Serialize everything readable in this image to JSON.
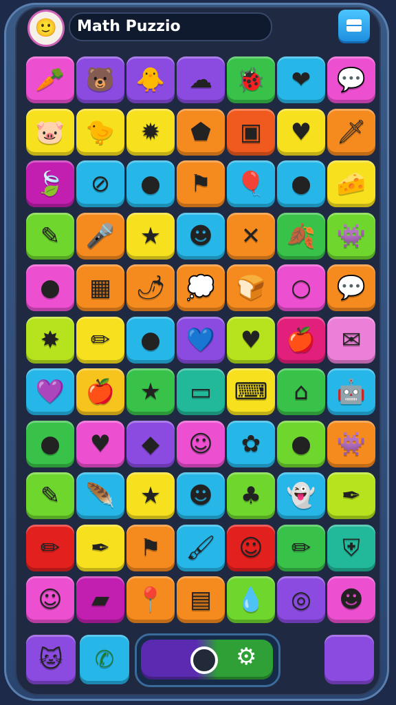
{
  "header": {
    "title": "Math Puzzio",
    "avatar_icon": "smiling-face-avatar",
    "menu_icon": "window-icon"
  },
  "tiles": [
    {
      "color": "#ec4fd0",
      "icon": "leaf-icon",
      "glyph": "🥕"
    },
    {
      "color": "#8b4be0",
      "icon": "bear-icon",
      "glyph": "🐻"
    },
    {
      "color": "#8b4be0",
      "icon": "chick-icon",
      "glyph": "🐥"
    },
    {
      "color": "#8b4be0",
      "icon": "blob-icon",
      "glyph": "☁"
    },
    {
      "color": "#39c24a",
      "icon": "bug-face-icon",
      "glyph": "🐞"
    },
    {
      "color": "#26b6e8",
      "icon": "heart-icon",
      "glyph": "❤"
    },
    {
      "color": "#ec4fd0",
      "icon": "speech-bubble-icon",
      "glyph": "💬"
    },
    {
      "color": "#f7e01e",
      "icon": "piggy-icon",
      "glyph": "🐷"
    },
    {
      "color": "#f7e01e",
      "icon": "chick-icon",
      "glyph": "🐤"
    },
    {
      "color": "#f7e01e",
      "icon": "blob-icon",
      "glyph": "✹"
    },
    {
      "color": "#f58a1e",
      "icon": "gem-icon",
      "glyph": "⬟"
    },
    {
      "color": "#f05a1e",
      "icon": "calculator-icon",
      "glyph": "▣"
    },
    {
      "color": "#f7e01e",
      "icon": "heart-coin-icon",
      "glyph": "♥"
    },
    {
      "color": "#f58a1e",
      "icon": "sword-icon",
      "glyph": "🗡"
    },
    {
      "color": "#c21fb0",
      "icon": "leaf-icon",
      "glyph": "🍃"
    },
    {
      "color": "#26b6e8",
      "icon": "slash-circle-icon",
      "glyph": "⊘"
    },
    {
      "color": "#26b6e8",
      "icon": "button-icon",
      "glyph": "●"
    },
    {
      "color": "#f58a1e",
      "icon": "flag-icon",
      "glyph": "⚑"
    },
    {
      "color": "#26b6e8",
      "icon": "balloon-icon",
      "glyph": "🎈"
    },
    {
      "color": "#26b6e8",
      "icon": "button-icon",
      "glyph": "●"
    },
    {
      "color": "#f7e01e",
      "icon": "cheese-icon",
      "glyph": "🧀"
    },
    {
      "color": "#6fd62e",
      "icon": "pencil-icon",
      "glyph": "✎"
    },
    {
      "color": "#f58a1e",
      "icon": "microphone-icon",
      "glyph": "🎤"
    },
    {
      "color": "#f7e01e",
      "icon": "star-icon",
      "glyph": "★"
    },
    {
      "color": "#26b6e8",
      "icon": "face-icon",
      "glyph": "☻"
    },
    {
      "color": "#f58a1e",
      "icon": "cross-icon",
      "glyph": "✕"
    },
    {
      "color": "#39c24a",
      "icon": "leaf-icon",
      "glyph": "🍂"
    },
    {
      "color": "#6fd62e",
      "icon": "blob-monster-icon",
      "glyph": "👾"
    },
    {
      "color": "#ec4fd0",
      "icon": "circle-icon",
      "glyph": "●"
    },
    {
      "color": "#f58a1e",
      "icon": "keypad-icon",
      "glyph": "▦"
    },
    {
      "color": "#f58a1e",
      "icon": "chili-icon",
      "glyph": "🌶"
    },
    {
      "color": "#f58a1e",
      "icon": "chat-icon",
      "glyph": "💭"
    },
    {
      "color": "#f58a1e",
      "icon": "bread-face-icon",
      "glyph": "🍞"
    },
    {
      "color": "#ec4fd0",
      "icon": "ring-icon",
      "glyph": "○"
    },
    {
      "color": "#f58a1e",
      "icon": "speech-bubble-icon",
      "glyph": "💬"
    },
    {
      "color": "#b7e21e",
      "icon": "splash-star-icon",
      "glyph": "✸"
    },
    {
      "color": "#f7e01e",
      "icon": "crayon-icon",
      "glyph": "✏"
    },
    {
      "color": "#26b6e8",
      "icon": "blob-icon",
      "glyph": "●"
    },
    {
      "color": "#8b4be0",
      "icon": "heart-bubble-icon",
      "glyph": "💙"
    },
    {
      "color": "#b7e21e",
      "icon": "heart-icon",
      "glyph": "♥"
    },
    {
      "color": "#e21f7a",
      "icon": "apple-icon",
      "glyph": "🍎"
    },
    {
      "color": "#ec7fd8",
      "icon": "envelope-icon",
      "glyph": "✉"
    },
    {
      "color": "#26b6e8",
      "icon": "heart-icon",
      "glyph": "💜"
    },
    {
      "color": "#f7c41e",
      "icon": "apple-icon",
      "glyph": "🍎"
    },
    {
      "color": "#39c24a",
      "icon": "star-icon",
      "glyph": "★"
    },
    {
      "color": "#22b89a",
      "icon": "box-face-icon",
      "glyph": "▭"
    },
    {
      "color": "#f7e01e",
      "icon": "keyboard-icon",
      "glyph": "⌨"
    },
    {
      "color": "#39c24a",
      "icon": "house-icon",
      "glyph": "⌂"
    },
    {
      "color": "#26b6e8",
      "icon": "robot-icon",
      "glyph": "🤖"
    },
    {
      "color": "#39c24a",
      "icon": "orange-icon",
      "glyph": "●"
    },
    {
      "color": "#ec4fd0",
      "icon": "heart-leaf-icon",
      "glyph": "♥"
    },
    {
      "color": "#8b4be0",
      "icon": "diamond-icon",
      "glyph": "◆"
    },
    {
      "color": "#ec4fd0",
      "icon": "face-icon",
      "glyph": "☺"
    },
    {
      "color": "#26b6e8",
      "icon": "flower-icon",
      "glyph": "✿"
    },
    {
      "color": "#6fd62e",
      "icon": "blob-icon",
      "glyph": "●"
    },
    {
      "color": "#f58a1e",
      "icon": "blob-monster-icon",
      "glyph": "👾"
    },
    {
      "color": "#6fd62e",
      "icon": "pencil-icon",
      "glyph": "✎"
    },
    {
      "color": "#26b6e8",
      "icon": "feather-icon",
      "glyph": "🪶"
    },
    {
      "color": "#f7e01e",
      "icon": "star-icon",
      "glyph": "★"
    },
    {
      "color": "#26b6e8",
      "icon": "face-icon",
      "glyph": "☻"
    },
    {
      "color": "#6fd62e",
      "icon": "clover-icon",
      "glyph": "♣"
    },
    {
      "color": "#26b6e8",
      "icon": "ghost-icon",
      "glyph": "👻"
    },
    {
      "color": "#b7e21e",
      "icon": "pen-icon",
      "glyph": "✒"
    },
    {
      "color": "#e2201e",
      "icon": "crayon-icon",
      "glyph": "✏"
    },
    {
      "color": "#f7e01e",
      "icon": "pen-icon",
      "glyph": "✒"
    },
    {
      "color": "#f58a1e",
      "icon": "pennant-icon",
      "glyph": "⚑"
    },
    {
      "color": "#26b6e8",
      "icon": "brush-icon",
      "glyph": "🖌"
    },
    {
      "color": "#e2201e",
      "icon": "face-icon",
      "glyph": "☺"
    },
    {
      "color": "#39c24a",
      "icon": "crayon-icon",
      "glyph": "✏"
    },
    {
      "color": "#22b89a",
      "icon": "shield-icon",
      "glyph": "⛨"
    },
    {
      "color": "#ec4fd0",
      "icon": "lion-face-icon",
      "glyph": "☺"
    },
    {
      "color": "#c21fb0",
      "icon": "eraser-icon",
      "glyph": "▰"
    },
    {
      "color": "#f58a1e",
      "icon": "pin-icon",
      "glyph": "📍"
    },
    {
      "color": "#f58a1e",
      "icon": "battery-icon",
      "glyph": "▤"
    },
    {
      "color": "#6fd62e",
      "icon": "drop-icon",
      "glyph": "💧"
    },
    {
      "color": "#8b4be0",
      "icon": "target-icon",
      "glyph": "◎"
    },
    {
      "color": "#ec4fd0",
      "icon": "smiley-icon",
      "glyph": "☻"
    }
  ],
  "bottom_bar": {
    "left_tile": {
      "color": "#8b4be0",
      "icon": "cat-icon",
      "glyph": "🐱"
    },
    "phone_tile": {
      "color": "#26b6e8",
      "icon": "phone-icon",
      "glyph": "✆"
    },
    "toggle_icon": "toggle-icon",
    "gear_icon": "gear-icon",
    "gear_glyph": "⚙",
    "right_tile": {
      "color": "#8b4be0",
      "icon": "blank-tile-icon",
      "glyph": ""
    }
  }
}
